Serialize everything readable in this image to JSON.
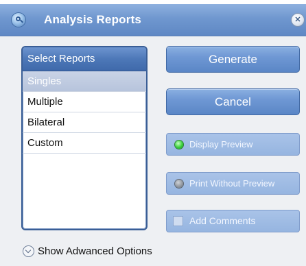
{
  "window": {
    "title": "Analysis Reports",
    "close_icon": "close-icon"
  },
  "reports_list": {
    "header": "Select Reports",
    "items": [
      {
        "label": "Singles",
        "selected": true
      },
      {
        "label": "Multiple",
        "selected": false
      },
      {
        "label": "Bilateral",
        "selected": false
      },
      {
        "label": "Custom",
        "selected": false
      }
    ]
  },
  "actions": {
    "generate_label": "Generate",
    "cancel_label": "Cancel",
    "display_preview_label": "Display Preview",
    "display_preview_on": true,
    "print_without_preview_label": "Print Without Preview",
    "print_without_preview_on": false,
    "add_comments_label": "Add Comments",
    "add_comments_checked": false
  },
  "footer": {
    "advanced_options_label": "Show Adwanced Options"
  },
  "colors": {
    "title_bar": "#6f97cf",
    "button": "#6f98d4",
    "list_header": "#4d78b8",
    "led_on": "#39d03a"
  }
}
